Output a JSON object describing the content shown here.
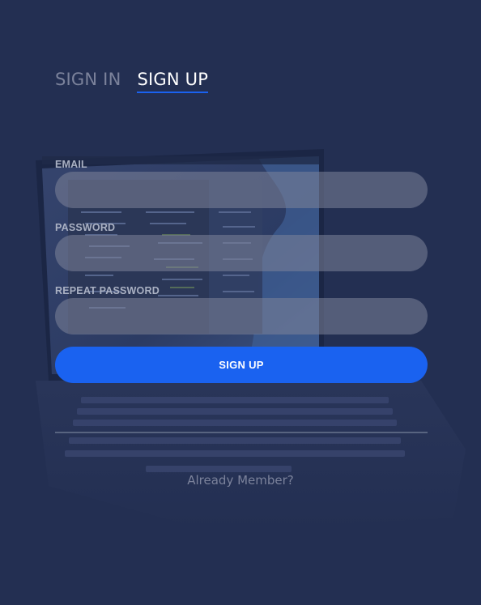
{
  "tabs": {
    "sign_in": "SIGN IN",
    "sign_up": "SIGN UP"
  },
  "form": {
    "email_label": "EMAIL",
    "email_value": "",
    "password_label": "PASSWORD",
    "password_value": "",
    "repeat_password_label": "REPEAT PASSWORD",
    "repeat_password_value": "",
    "submit_label": "SIGN UP"
  },
  "footer": {
    "already_member": "Already Member?"
  },
  "colors": {
    "background": "#232f52",
    "accent": "#1a62f0",
    "muted_text": "#7b829b",
    "field_fill": "#7d8499"
  }
}
